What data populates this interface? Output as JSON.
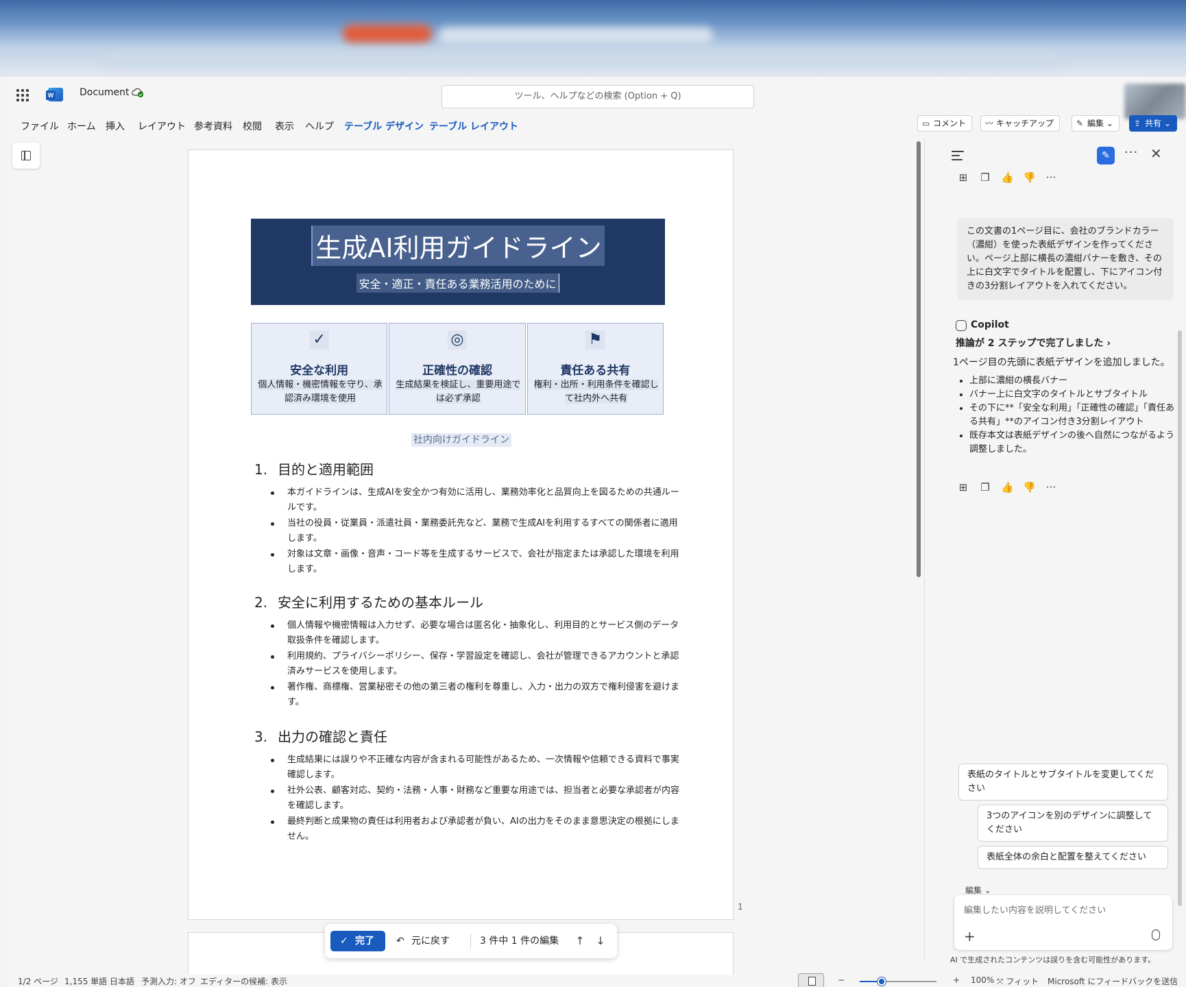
{
  "app": {
    "document_name": "Document",
    "search_placeholder": "ツール、ヘルプなどの検索 (Option + Q)"
  },
  "menu": {
    "items": [
      "ファイル",
      "ホーム",
      "挿入",
      "レイアウト",
      "参考資料",
      "校閲",
      "表示",
      "ヘルプ",
      "テーブル デザイン",
      "テーブル レイアウト"
    ],
    "active_items": [
      "テーブル デザイン",
      "テーブル レイアウト"
    ],
    "comment_label": "コメント",
    "catchup_label": "キャッチアップ",
    "edit_label": "編集",
    "share_label": "共有"
  },
  "document": {
    "banner_title": "生成AI利用ガイドライン",
    "banner_subtitle": "安全・適正・責任ある業務活用のために",
    "features": [
      {
        "icon": "✓",
        "title": "安全な利用",
        "desc": "個人情報・機密情報を守り、承認済み環境を使用"
      },
      {
        "icon": "◎",
        "title": "正確性の確認",
        "desc": "生成結果を検証し、重要用途では必ず承認"
      },
      {
        "icon": "⚑",
        "title": "責任ある共有",
        "desc": "権利・出所・利用条件を確認して社内外へ共有"
      }
    ],
    "caption": "社内向けガイドライン",
    "sections": [
      {
        "num": "1.",
        "heading": "目的と適用範囲",
        "bullets": [
          "本ガイドラインは、生成AIを安全かつ有効に活用し、業務効率化と品質向上を図るための共通ルールです。",
          "当社の役員・従業員・派遣社員・業務委託先など、業務で生成AIを利用するすべての関係者に適用します。",
          "対象は文章・画像・音声・コード等を生成するサービスで、会社が指定または承認した環境を利用します。"
        ]
      },
      {
        "num": "2.",
        "heading": "安全に利用するための基本ルール",
        "bullets": [
          "個人情報や機密情報は入力せず、必要な場合は匿名化・抽象化し、利用目的とサービス側のデータ取扱条件を確認します。",
          "利用規約、プライバシーポリシー、保存・学習設定を確認し、会社が管理できるアカウントと承認済みサービスを使用します。",
          "著作権、商標権、営業秘密その他の第三者の権利を尊重し、入力・出力の双方で権利侵害を避けます。"
        ]
      },
      {
        "num": "3.",
        "heading": "出力の確認と責任",
        "bullets": [
          "生成結果には誤りや不正確な内容が含まれる可能性があるため、一次情報や信頼できる資料で事実確認します。",
          "社外公表、顧客対応、契約・法務・人事・財務など重要な用途では、担当者と必要な承認者が内容を確認します。",
          "最終判断と成果物の責任は利用者および承認者が負い、AIの出力をそのまま意思決定の根拠にしません。"
        ]
      }
    ],
    "page_number": "1"
  },
  "review_bar": {
    "done_label": "完了",
    "undo_label": "元に戻す",
    "count_label": "3 件中 1 件の編集"
  },
  "status": {
    "page": "1/2 ページ",
    "words": "1,155 単語",
    "language": "日本語",
    "prediction": "予測入力: オフ",
    "editor": "エディターの候補: 表示",
    "zoom": "100%",
    "fit": "フィット",
    "feedback": "Microsoft にフィードバックを送信"
  },
  "copilot": {
    "user_message": "この文書の1ページ目に、会社のブランドカラー（濃紺）を使った表紙デザインを作ってください。ページ上部に横長の濃紺バナーを敷き、その上に白文字でタイトルを配置し、下にアイコン付きの3分割レイアウトを入れてください。",
    "assistant_name": "Copilot",
    "reasoning": "推論が 2 ステップで完了しました",
    "summary": "1ページ目の先頭に表紙デザインを追加しました。",
    "bullets": [
      "上部に濃紺の横長バナー",
      "バナー上に白文字のタイトルとサブタイトル",
      "その下に**「安全な利用」「正確性の確認」「責任ある共有」**のアイコン付き3分割レイアウト",
      "既存本文は表紙デザインの後へ自然につながるよう調整しました。"
    ],
    "suggestions": [
      "表紙のタイトルとサブタイトルを変更してください",
      "3つのアイコンを別のデザインに調整してください",
      "表紙全体の余白と配置を整えてください"
    ],
    "mode_label": "編集",
    "prompt_placeholder": "編集したい内容を説明してください",
    "disclaimer": "AI で生成されたコンテンツは誤りを含む可能性があります。"
  },
  "colors": {
    "brand_navy": "#1f3864",
    "accent_blue": "#185abd",
    "feature_bg": "#e8edf7"
  }
}
